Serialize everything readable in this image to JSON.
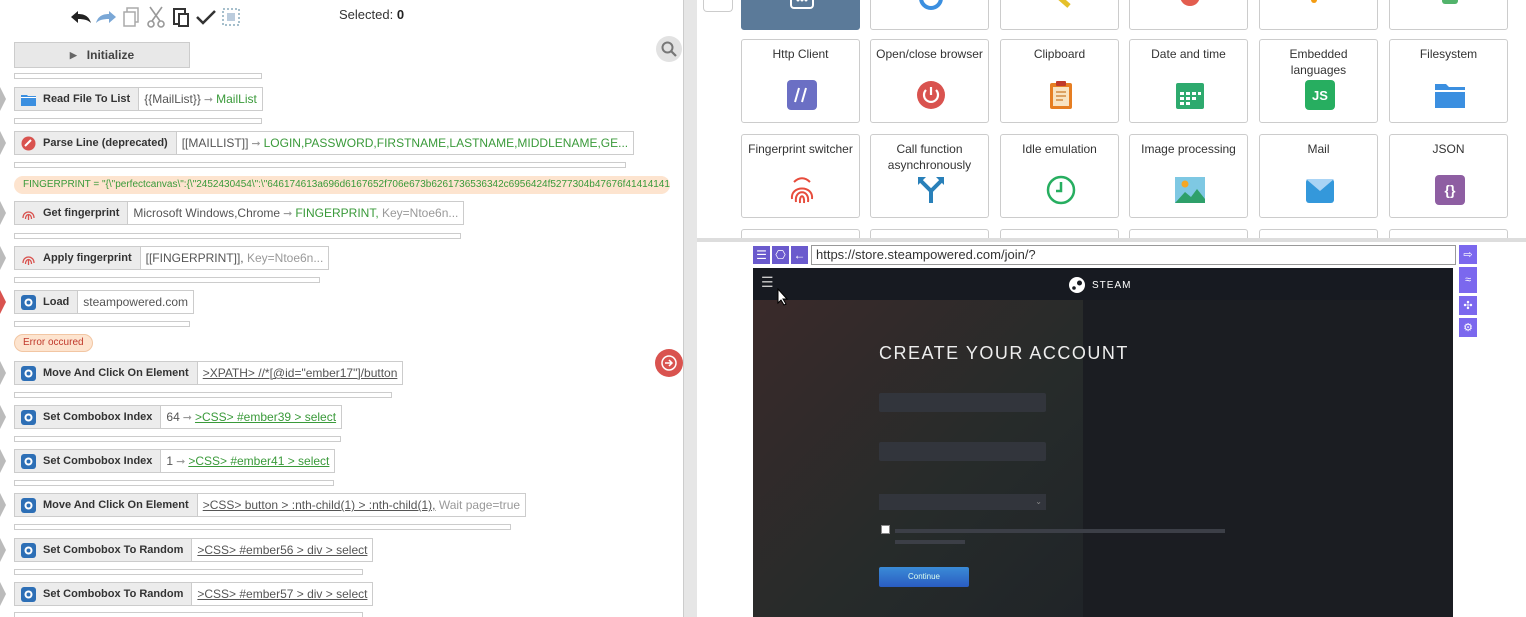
{
  "toolbar": {
    "selected_label": "Selected:",
    "selected_count": "0",
    "icons": [
      "undo-icon",
      "redo-icon",
      "copy-icon",
      "cut-icon",
      "paste-icon",
      "check-icon",
      "select-all-icon"
    ]
  },
  "initialize": {
    "label": "Initialize"
  },
  "actions": [
    {
      "name": "Read File To List",
      "icon": "folder-icon"
    },
    {
      "name": "Parse Line (deprecated)",
      "icon": "parse-icon"
    },
    {
      "name": "Get fingerprint",
      "icon": "fingerprint-icon"
    },
    {
      "name": "Apply fingerprint",
      "icon": "fingerprint-icon"
    },
    {
      "name": "Load",
      "icon": "browser-icon"
    },
    {
      "name": "Move And Click On Element",
      "icon": "browser-icon"
    },
    {
      "name": "Set Combobox Index",
      "icon": "browser-icon"
    },
    {
      "name": "Set Combobox Index",
      "icon": "browser-icon"
    },
    {
      "name": "Move And Click On Element",
      "icon": "browser-icon"
    },
    {
      "name": "Set Combobox To Random",
      "icon": "browser-icon"
    },
    {
      "name": "Set Combobox To Random",
      "icon": "browser-icon"
    }
  ],
  "params": {
    "read_in": "{{MailList}}",
    "read_out": "MailList",
    "parse_in": "[[MAILLIST]]",
    "parse_out": "LOGIN,PASSWORD,FIRSTNAME,LASTNAME,MIDDLENAME,GE...",
    "getfp_in": "Microsoft Windows,Chrome",
    "getfp_out": "FINGERPRINT,",
    "getfp_key": "Key=Ntoe6n...",
    "applyfp_in": "[[FINGERPRINT]],",
    "applyfp_key": "Key=Ntoe6n...",
    "load_url": "steampowered.com",
    "click1": ">XPATH> //*[@id=\"ember17\"]/button",
    "combo1_idx": "64",
    "combo1_sel": ">CSS> #ember39 > select",
    "combo2_idx": "1",
    "combo2_sel": ">CSS> #ember41 > select",
    "click2": ">CSS> button > :nth-child(1) > :nth-child(1),",
    "click2_wait": "Wait page=true",
    "rand1": ">CSS> #ember56 > div > select",
    "rand2": ">CSS> #ember57 > div > select"
  },
  "fingerprint_banner": "FINGERPRINT = \"{\\\"perfectcanvas\\\":{\\\"2452430454\\\":\\\"646174613a696d6167652f706e673b6261736536342c6956424f5277304b47676f41414141...",
  "error_label": "Error occured",
  "tiles": [
    {
      "label": "Http Client",
      "icon": "http-icon",
      "color": "#6b6fc4"
    },
    {
      "label": "Open/close browser",
      "icon": "power-icon",
      "color": "#d9534f"
    },
    {
      "label": "Clipboard",
      "icon": "clipboard-icon",
      "color": "#e67e22"
    },
    {
      "label": "Date and time",
      "icon": "calendar-icon",
      "color": "#2eaa6e"
    },
    {
      "label": "Embedded languages",
      "icon": "js-icon",
      "color": "#27ae60"
    },
    {
      "label": "Filesystem",
      "icon": "folder-icon",
      "color": "#3b8fe0"
    },
    {
      "label": "Fingerprint switcher",
      "icon": "fingerprint-icon",
      "color": "#e74c3c"
    },
    {
      "label": "Call function asynchronously",
      "icon": "fork-icon",
      "color": "#2980b9"
    },
    {
      "label": "Idle emulation",
      "icon": "clock-icon",
      "color": "#27ae60"
    },
    {
      "label": "Image processing",
      "icon": "image-icon",
      "color": "#3aa7c9"
    },
    {
      "label": "Mail",
      "icon": "mail-icon",
      "color": "#3498db"
    },
    {
      "label": "JSON",
      "icon": "json-icon",
      "color": "#8e5ea2"
    }
  ],
  "browser": {
    "url": "https://store.steampowered.com/join/?",
    "steam_label": "STEAM",
    "heading": "CREATE YOUR ACCOUNT",
    "continue_label": "Continue"
  }
}
